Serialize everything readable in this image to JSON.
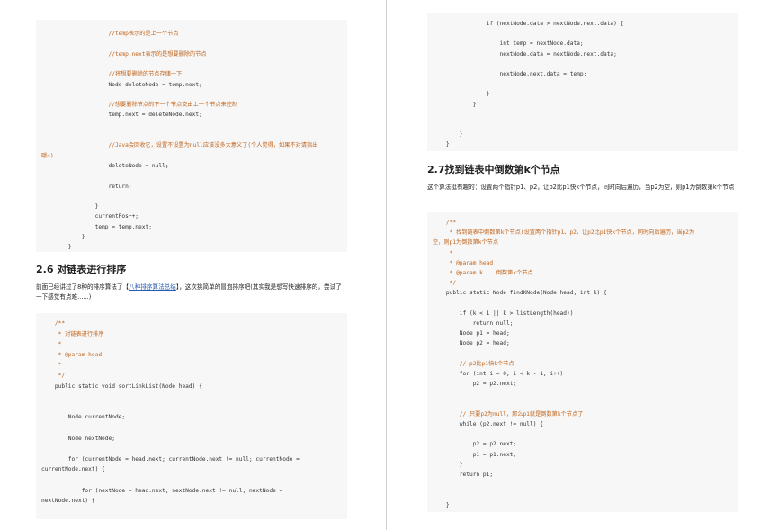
{
  "left": {
    "code_top": [
      "                    //temp表示的是上一个节点",
      "",
      "                    //temp.next表示的是想要删除的节点",
      "",
      "                    //将想要删除的节点存储一下",
      "                    Node deleteNode = temp.next;",
      "",
      "                    //想要删除节点的下一个节点交由上一个节点来控制",
      "                    temp.next = deleteNode.next;",
      "",
      "",
      "                    //Java会回收它，设置不设置为null应该没多大意义了(个人觉得，如果不对请指出",
      "哦~)",
      "                    deleteNode = null;",
      "",
      "                    return;",
      "",
      "                }",
      "                currentPos++;",
      "                temp = temp.next;",
      "            }",
      "        }"
    ],
    "heading": "2.6 对链表进行排序",
    "para_prefix": "前面已经讲过了8种的排序算法了【",
    "para_link": "八种排序算法总结",
    "para_suffix": "】，这次挑简单的冒泡排序吧(其实我是想写快速排序的，尝试了一下感觉有点难......)",
    "code_bottom": [
      "    /**",
      "     * 对链表进行排序",
      "     *",
      "     * @param head",
      "     *",
      "     */",
      "    public static void sortLinkList(Node head) {",
      "",
      "",
      "        Node currentNode;",
      "",
      "        Node nextNode;",
      "",
      "        for (currentNode = head.next; currentNode.next != null; currentNode =",
      "currentNode.next) {",
      "",
      "            for (nextNode = head.next; nextNode.next != null; nextNode =",
      "nextNode.next) {"
    ]
  },
  "right": {
    "code_top": [
      "                if (nextNode.data > nextNode.next.data) {",
      "",
      "                    int temp = nextNode.data;",
      "                    nextNode.data = nextNode.next.data;",
      "",
      "                    nextNode.next.data = temp;",
      "",
      "                }",
      "            }",
      "",
      "",
      "        }",
      "    }"
    ],
    "heading": "2.7找到链表中倒数第k个节点",
    "para": "这个算法挺有趣的：设置两个指针p1、p2，让p2比p1快k个节点，同时向后遍历，当p2为空，则p1为倒数第k个节点",
    "code_bottom": [
      "    /**",
      "     * 找到链表中倒数第k个节点(设置两个指针p1、p2，让p2比p1快k个节点，同时向后遍历，当p2为",
      "空，则p1为倒数第k个节点",
      "     *",
      "     * @param head",
      "     * @param k    倒数第k个节点",
      "     */",
      "    public static Node findKNode(Node head, int k) {",
      "",
      "        if (k < 1 || k > listLength(head))",
      "            return null;",
      "        Node p1 = head;",
      "        Node p2 = head;",
      "",
      "        // p2比p1快k个节点",
      "        for (int i = 0; i < k - 1; i++)",
      "            p2 = p2.next;",
      "",
      "",
      "        // 只要p2为null，那么p1就是倒数第k个节点了",
      "        while (p2.next != null) {",
      "",
      "            p2 = p2.next;",
      "            p1 = p1.next;",
      "        }",
      "        return p1;",
      "",
      "",
      "    }"
    ]
  }
}
